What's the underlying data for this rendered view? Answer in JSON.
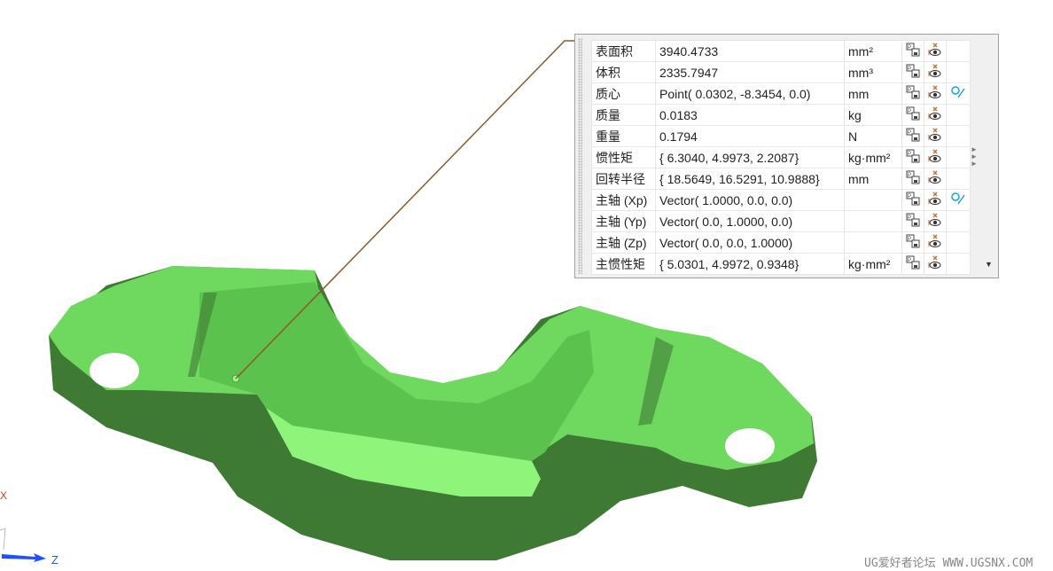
{
  "properties": [
    {
      "label": "表面积",
      "value": "3940.4733",
      "unit": "mm²",
      "has_vector": false
    },
    {
      "label": "体积",
      "value": "2335.7947",
      "unit": "mm³",
      "has_vector": false
    },
    {
      "label": "质心",
      "value": "Point( 0.0302, -8.3454, 0.0)",
      "unit": "mm",
      "has_vector": true
    },
    {
      "label": "质量",
      "value": "0.0183",
      "unit": "kg",
      "has_vector": false
    },
    {
      "label": "重量",
      "value": "0.1794",
      "unit": "N",
      "has_vector": false
    },
    {
      "label": "惯性矩",
      "value": "{ 6.3040, 4.9973, 2.2087}",
      "unit": "kg·mm²",
      "has_vector": false
    },
    {
      "label": "回转半径",
      "value": "{ 18.5649, 16.5291, 10.9888}",
      "unit": "mm",
      "has_vector": false
    },
    {
      "label": "主轴 (Xp)",
      "value": "Vector( 1.0000, 0.0, 0.0)",
      "unit": "",
      "has_vector": true
    },
    {
      "label": "主轴 (Yp)",
      "value": "Vector( 0.0, 1.0000, 0.0)",
      "unit": "",
      "has_vector": false
    },
    {
      "label": "主轴 (Zp)",
      "value": "Vector( 0.0, 0.0, 1.0000)",
      "unit": "",
      "has_vector": false
    },
    {
      "label": "主惯性矩",
      "value": "{ 5.0301, 4.9972, 0.9348}",
      "unit": "kg·mm²",
      "has_vector": false
    }
  ],
  "axes": {
    "x": "X",
    "z": "Z"
  },
  "watermark": "UG爱好者论坛 WWW.UGSNX.COM",
  "colors": {
    "part_top": "#6fd95f",
    "part_side": "#3e7a34",
    "part_highlight": "#8ef57a",
    "vector_icon": "#1aa3d9",
    "hide_icon": "#e06a1a"
  }
}
